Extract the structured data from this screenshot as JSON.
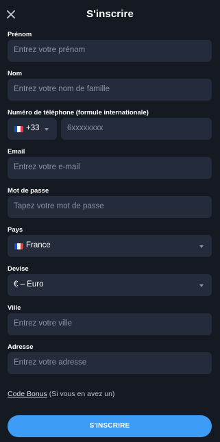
{
  "header": {
    "title": "S'inscrire"
  },
  "form": {
    "prenom": {
      "label": "Prénom",
      "placeholder": "Entrez votre prénom"
    },
    "nom": {
      "label": "Nom",
      "placeholder": "Entrez votre nom de famille"
    },
    "phone": {
      "label": "Numéro de téléphone (formule internationale)",
      "country_code": "+33",
      "placeholder": "6xxxxxxxx"
    },
    "email": {
      "label": "Email",
      "placeholder": "Entrez votre e-mail"
    },
    "password": {
      "label": "Mot de passe",
      "placeholder": "Tapez votre mot de passe"
    },
    "pays": {
      "label": "Pays",
      "value": "France"
    },
    "devise": {
      "label": "Devise",
      "value": "€ – Euro"
    },
    "ville": {
      "label": "Ville",
      "placeholder": "Entrez votre ville"
    },
    "adresse": {
      "label": "Adresse",
      "placeholder": "Entrez votre adresse"
    }
  },
  "bonus": {
    "link": "Code Bonus",
    "note": " (Si vous en avez un)"
  },
  "submit_label": "S'INSCRIRE",
  "icons": {
    "close": "close-icon",
    "flag": "france-flag-icon",
    "dropdown": "chevron-down-icon"
  },
  "colors": {
    "background": "#151a22",
    "field": "#242c3b",
    "placeholder": "#8a94a6",
    "accent": "#3d9cf5",
    "flag_blue": "#1f4fbf",
    "flag_white": "#ffffff",
    "flag_red": "#e63946"
  }
}
